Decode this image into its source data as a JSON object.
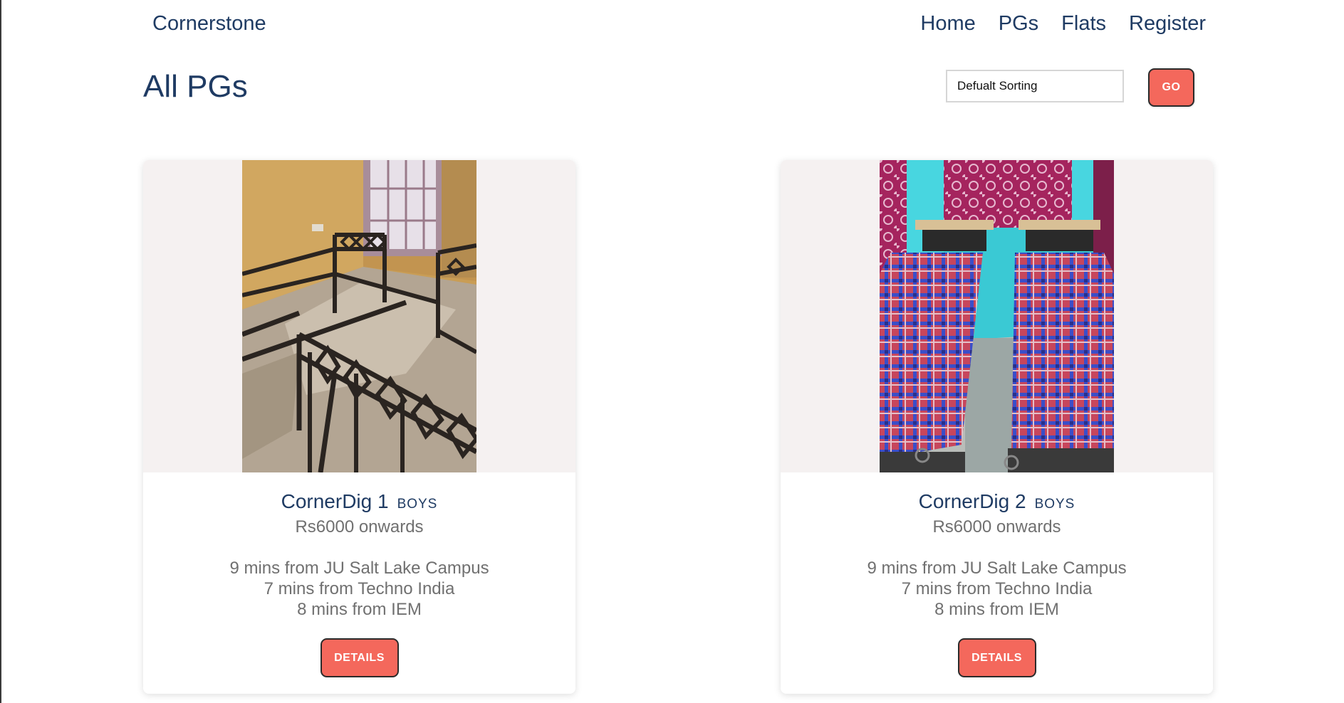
{
  "navbar": {
    "brand": "Cornerstone",
    "links": [
      "Home",
      "PGs",
      "Flats",
      "Register"
    ]
  },
  "header": {
    "title": "All PGs",
    "sort_value": "Defualt Sorting",
    "go_label": "GO"
  },
  "colors": {
    "primary": "#1f3b63",
    "accent": "#f4685c",
    "muted_text": "#707070",
    "photo_background": "#f5f1f1"
  },
  "listings": [
    {
      "name": "CornerDig 1",
      "tag": "BOYS",
      "price": "Rs6000 onwards",
      "distances": [
        "9 mins from JU Salt Lake Campus",
        "7 mins from Techno India",
        "8 mins from IEM"
      ],
      "details_label": "DETAILS",
      "photo": "room with empty metal bed frames"
    },
    {
      "name": "CornerDig 2",
      "tag": "BOYS",
      "price": "Rs6000 onwards",
      "distances": [
        "9 mins from JU Salt Lake Campus",
        "7 mins from Techno India",
        "8 mins from IEM"
      ],
      "details_label": "DETAILS",
      "photo": "room with two beds with checked mattresses"
    }
  ]
}
